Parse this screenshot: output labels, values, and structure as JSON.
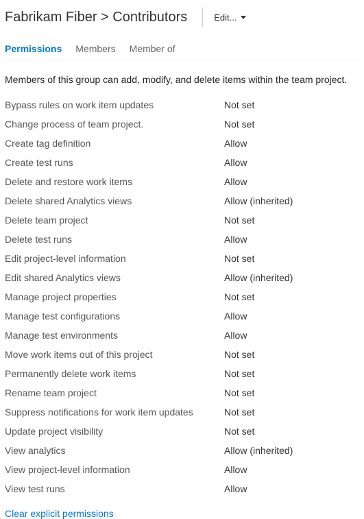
{
  "header": {
    "project": "Fabrikam Fiber",
    "separator": ">",
    "group": "Contributors",
    "edit_label": "Edit..."
  },
  "tabs": {
    "permissions": "Permissions",
    "members": "Members",
    "member_of": "Member of"
  },
  "description": "Members of this group can add, modify, and delete items within the team project.",
  "permissions": [
    {
      "name": "Bypass rules on work item updates",
      "value": "Not set"
    },
    {
      "name": "Change process of team project.",
      "value": "Not set"
    },
    {
      "name": "Create tag definition",
      "value": "Allow"
    },
    {
      "name": "Create test runs",
      "value": "Allow"
    },
    {
      "name": "Delete and restore work items",
      "value": "Allow"
    },
    {
      "name": "Delete shared Analytics views",
      "value": "Allow (inherited)"
    },
    {
      "name": "Delete team project",
      "value": "Not set"
    },
    {
      "name": "Delete test runs",
      "value": "Allow"
    },
    {
      "name": "Edit project-level information",
      "value": "Not set"
    },
    {
      "name": "Edit shared Analytics views",
      "value": "Allow (inherited)"
    },
    {
      "name": "Manage project properties",
      "value": "Not set"
    },
    {
      "name": "Manage test configurations",
      "value": "Allow"
    },
    {
      "name": "Manage test environments",
      "value": "Allow"
    },
    {
      "name": "Move work items out of this project",
      "value": "Not set"
    },
    {
      "name": "Permanently delete work items",
      "value": "Not set"
    },
    {
      "name": "Rename team project",
      "value": "Not set"
    },
    {
      "name": "Suppress notifications for work item updates",
      "value": "Not set"
    },
    {
      "name": "Update project visibility",
      "value": "Not set"
    },
    {
      "name": "View analytics",
      "value": "Allow (inherited)"
    },
    {
      "name": "View project-level information",
      "value": "Allow"
    },
    {
      "name": "View test runs",
      "value": "Allow"
    }
  ],
  "clear_link": "Clear explicit permissions"
}
